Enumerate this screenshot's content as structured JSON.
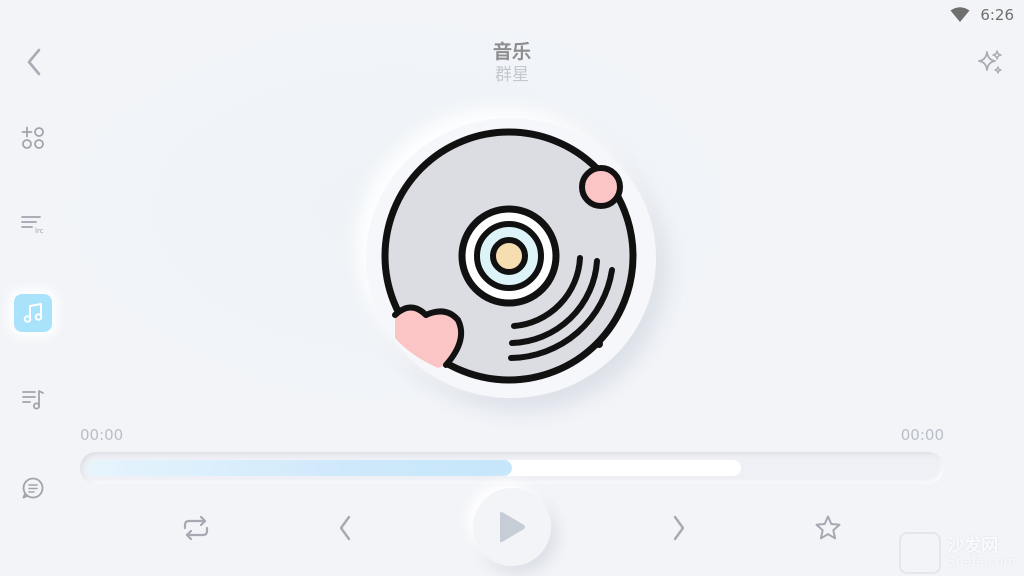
{
  "status": {
    "time": "6:26",
    "wifi_icon": "wifi-icon"
  },
  "header": {
    "title": "音乐",
    "subtitle": "群星",
    "back_icon": "chevron-left-icon",
    "sparkle_icon": "sparkle-icon"
  },
  "sidebar": {
    "items": [
      {
        "icon": "apps-add-icon",
        "active": false
      },
      {
        "icon": "equalizer-icon",
        "active": false
      },
      {
        "icon": "music-note-icon",
        "active": true
      },
      {
        "icon": "playlist-icon",
        "active": false
      },
      {
        "icon": "lyrics-icon",
        "active": false
      }
    ]
  },
  "player": {
    "album_art": "vinyl-disc-heart-icon",
    "elapsed": "00:00",
    "duration": "00:00",
    "progress_fraction": 0.5,
    "buffer_fraction": 0.77
  },
  "controls": [
    {
      "icon": "repeat-icon"
    },
    {
      "icon": "previous-icon"
    },
    {
      "icon": "play-icon"
    },
    {
      "icon": "next-icon"
    },
    {
      "icon": "star-icon"
    }
  ],
  "watermark": {
    "text": "沙发网",
    "sub": "Shafa.com"
  },
  "colors": {
    "accent": "#a9e2fb",
    "icon": "#a0a4ad",
    "disc_heart": "#fcc5c5",
    "disc_center": "#f6deb1"
  }
}
